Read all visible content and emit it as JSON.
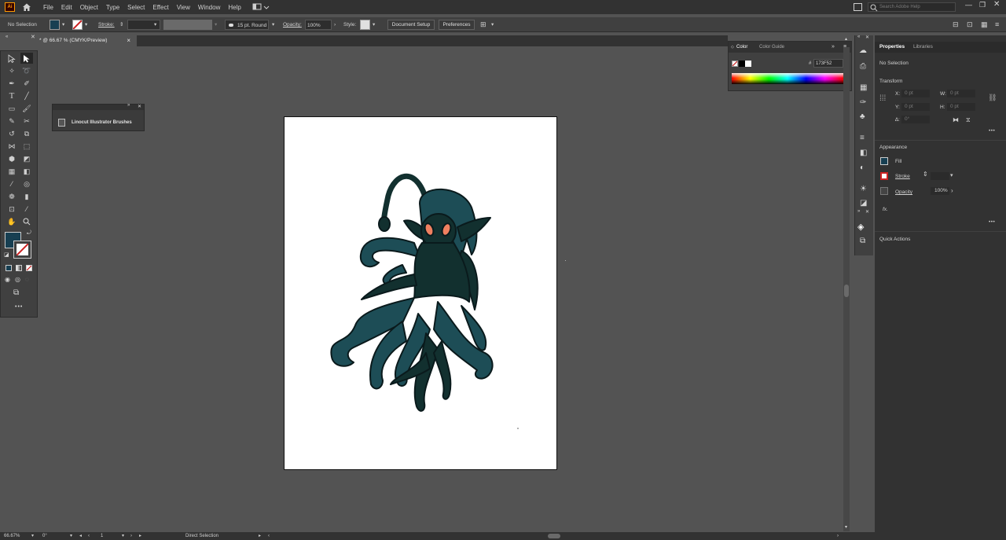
{
  "app": {
    "logo": "Ai"
  },
  "menu": [
    "File",
    "Edit",
    "Object",
    "Type",
    "Select",
    "Effect",
    "View",
    "Window",
    "Help"
  ],
  "search": {
    "placeholder": "Search Adobe Help"
  },
  "control": {
    "selection": "No Selection",
    "stroke_label": "Stroke:",
    "brush": "15 pt. Round",
    "opacity_label": "Opacity:",
    "opacity": "100%",
    "style_label": "Style:",
    "document_setup": "Document Setup",
    "preferences": "Preferences"
  },
  "doc_tab": {
    "title": "* @ 66.67 % (CMYK/Preview)",
    "close": "×"
  },
  "brush_panel": {
    "title": "Linocut Illustrator Brushes"
  },
  "color_panel": {
    "tabs": [
      "Color",
      "Color Guide"
    ],
    "hash": "#",
    "hex": "173F52"
  },
  "properties": {
    "tabs": [
      "Properties",
      "Libraries"
    ],
    "selection": "No Selection",
    "transform_title": "Transform",
    "x_label": "X:",
    "x_val": "0 pt",
    "y_label": "Y:",
    "y_val": "0 pt",
    "w_label": "W:",
    "w_val": "0 pt",
    "h_label": "H:",
    "h_val": "0 pt",
    "angle_label": "∆:",
    "angle_val": "0°",
    "appearance_title": "Appearance",
    "fill_label": "Fill",
    "stroke_label": "Stroke",
    "opacity_label": "Opacity",
    "opacity_val": "100%",
    "fx": "fx.",
    "quick_actions": "Quick Actions",
    "more": "•••"
  },
  "status": {
    "zoom": "66.67%",
    "rotation": "0°",
    "artboard": "1",
    "tool": "Direct Selection"
  },
  "colors": {
    "fill": "#173F52",
    "stroke": "#cc2222",
    "creature_dark": "#12302f",
    "creature_mid": "#1d4d56",
    "eye": "#f08060"
  }
}
